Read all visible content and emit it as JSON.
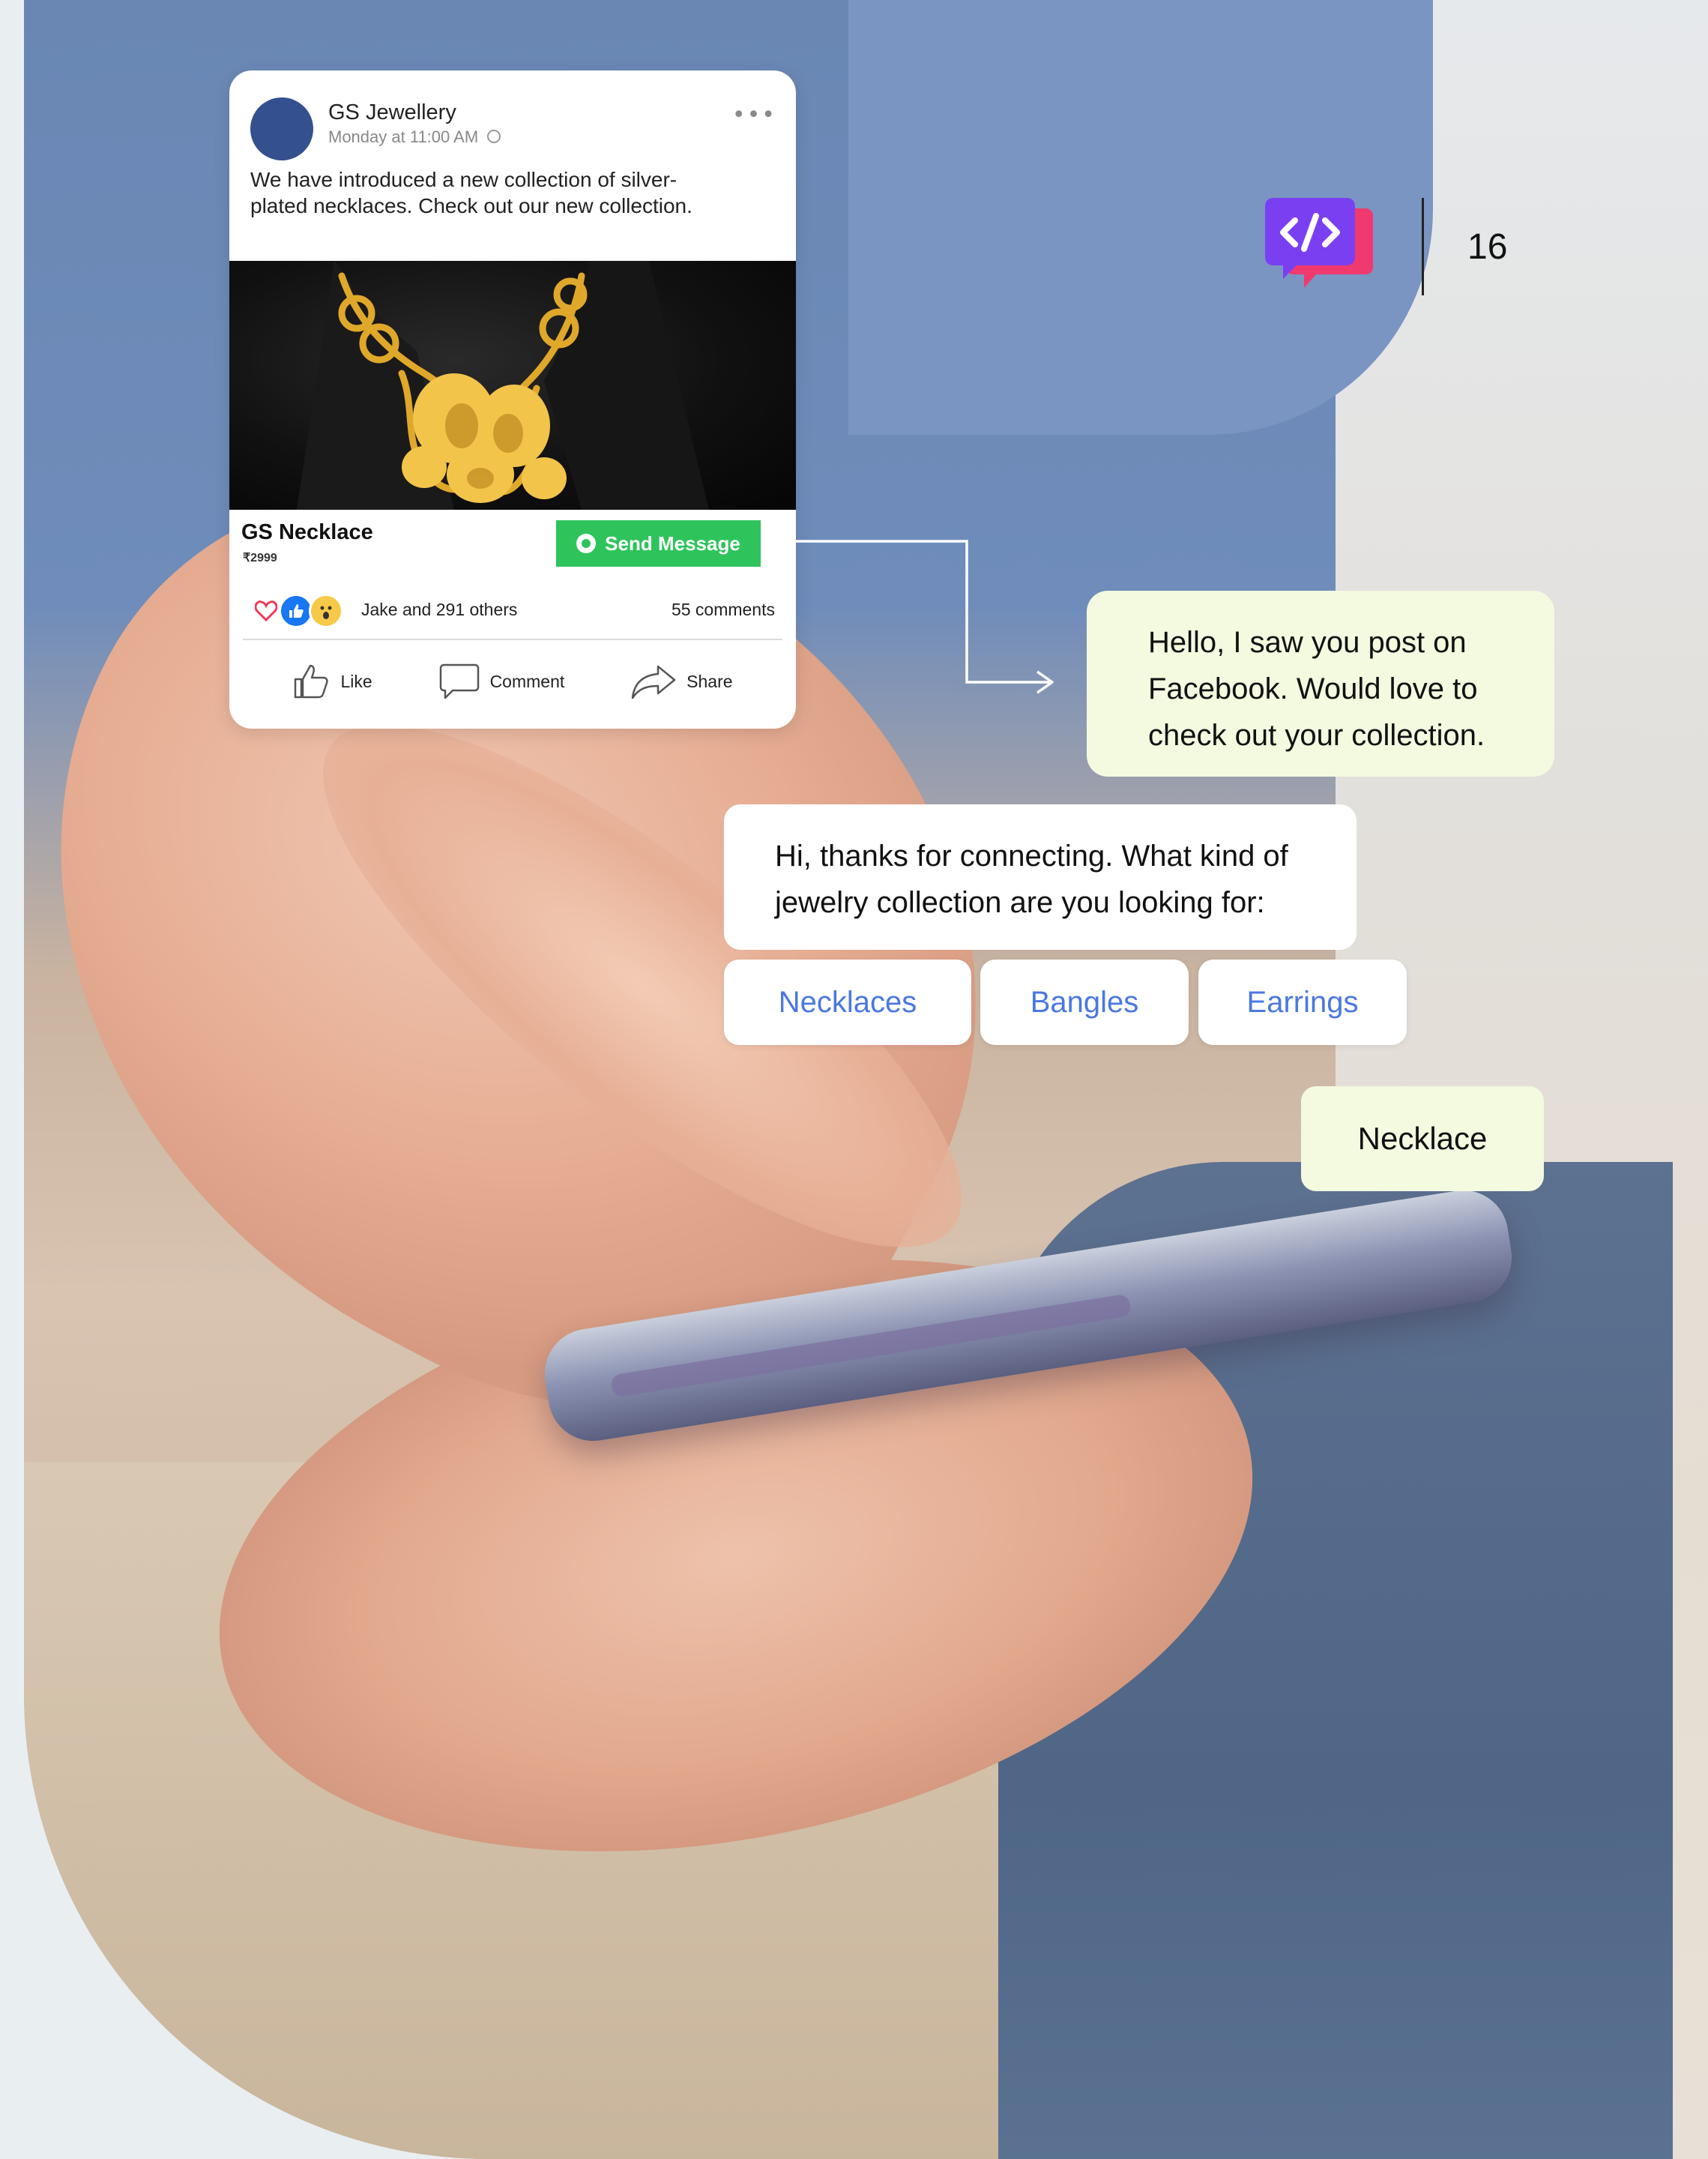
{
  "post": {
    "page_name": "GS Jewellery",
    "time": "Monday at 11:00 AM",
    "text": "We have introduced a new collection of silver-plated necklaces. Check out our new collection.",
    "product_title": "GS Necklace",
    "product_price": "₹2999",
    "cta_label": "Send Message",
    "reactions_text": "Jake and 291 others",
    "comments_text": "55 comments",
    "actions": {
      "like": "Like",
      "comment": "Comment",
      "share": "Share"
    }
  },
  "chat": {
    "user_message_1": "Hello, I saw you post on Facebook. Would love to check out your collection.",
    "bot_message": "Hi, thanks for connecting. What kind of jewelry collection are you looking for:",
    "quick_replies": [
      "Necklaces",
      "Bangles",
      "Earrings"
    ],
    "user_message_2": "Necklace"
  },
  "page_number": "16",
  "colors": {
    "brand_purple": "#7b3ff2",
    "brand_pink": "#f0396e",
    "whatsapp_green": "#2ec45b",
    "user_bubble": "#f3fadf",
    "quick_reply_text": "#4a78e0",
    "facebook_avatar": "#35508f"
  },
  "icons": [
    "more-dots-icon",
    "globe-icon",
    "whatsapp-icon",
    "love-reaction-icon",
    "like-reaction-icon",
    "wow-reaction-icon",
    "like-icon",
    "comment-icon",
    "share-icon",
    "connector-arrow-icon",
    "code-chat-logo-icon"
  ]
}
